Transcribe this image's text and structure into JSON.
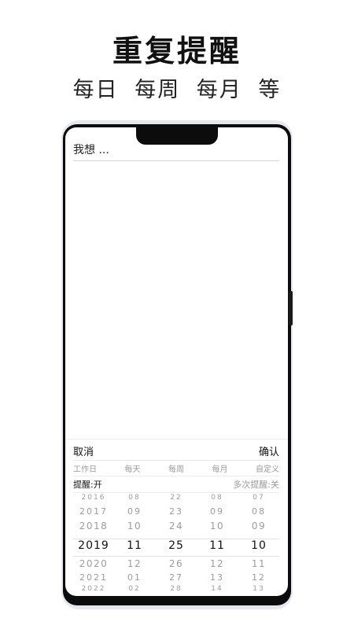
{
  "promo": {
    "headline": "重复提醒",
    "subs": [
      "每日",
      "每周",
      "每月",
      "等"
    ]
  },
  "app": {
    "input_placeholder": "我想 ...",
    "sheet": {
      "cancel_label": "取消",
      "confirm_label": "确认",
      "repeat_options": [
        "工作日",
        "每天",
        "每周",
        "每月",
        "自定义"
      ],
      "reminder_toggle": "提醒:开",
      "multi_reminder_toggle": "多次提醒:关"
    },
    "picker": {
      "columns": [
        {
          "name": "year",
          "values": [
            "2016",
            "2017",
            "2018",
            "2019",
            "2020",
            "2021",
            "2022"
          ],
          "selected": "2019"
        },
        {
          "name": "month",
          "values": [
            "08",
            "09",
            "10",
            "11",
            "12",
            "01",
            "02"
          ],
          "selected": "11"
        },
        {
          "name": "day",
          "values": [
            "22",
            "23",
            "24",
            "25",
            "26",
            "27",
            "28"
          ],
          "selected": "25"
        },
        {
          "name": "hour",
          "values": [
            "08",
            "09",
            "10",
            "11",
            "12",
            "13",
            "14"
          ],
          "selected": "11"
        },
        {
          "name": "minute",
          "values": [
            "07",
            "08",
            "09",
            "10",
            "11",
            "12",
            "13"
          ],
          "selected": "10"
        }
      ]
    }
  },
  "colors": {
    "accent_text": "#111111",
    "muted_text": "#9a9a9a",
    "phone_frame": "#0c0c0c"
  }
}
